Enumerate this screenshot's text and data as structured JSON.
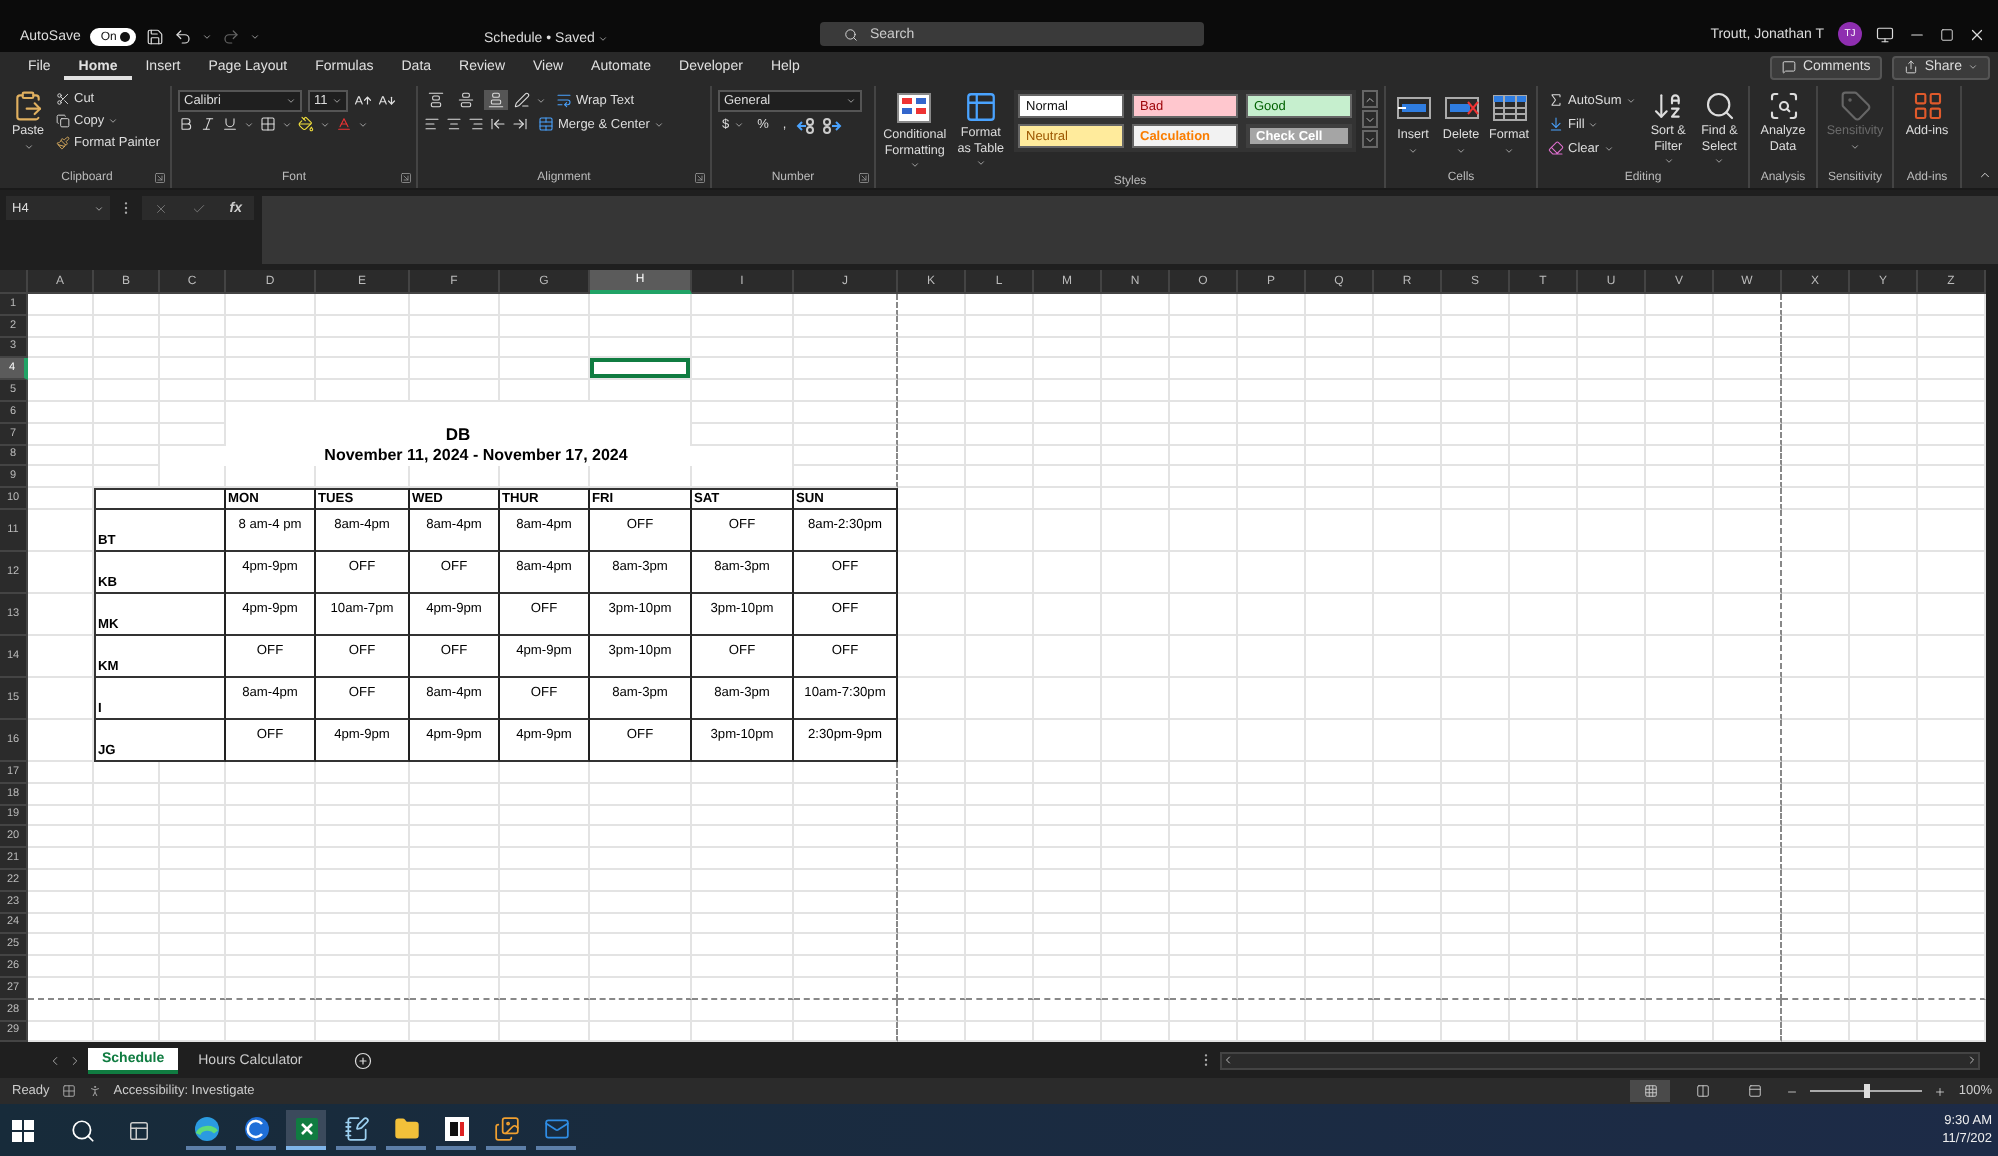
{
  "title_bar": {
    "autosave_label": "AutoSave",
    "autosave_state": "On",
    "autosave_on": true,
    "document_title": "Schedule • Saved",
    "search_placeholder": "Search",
    "user_name": "Troutt, Jonathan T",
    "user_initials": "TJ"
  },
  "menu_tabs": [
    {
      "label": "File",
      "selected": false
    },
    {
      "label": "Home",
      "selected": true
    },
    {
      "label": "Insert",
      "selected": false
    },
    {
      "label": "Page Layout",
      "selected": false
    },
    {
      "label": "Formulas",
      "selected": false
    },
    {
      "label": "Data",
      "selected": false
    },
    {
      "label": "Review",
      "selected": false
    },
    {
      "label": "View",
      "selected": false
    },
    {
      "label": "Automate",
      "selected": false
    },
    {
      "label": "Developer",
      "selected": false
    },
    {
      "label": "Help",
      "selected": false
    }
  ],
  "comments_button": "Comments",
  "share_button": "Share",
  "ribbon_groups": [
    {
      "kind": "clipboard",
      "label": "Clipboard",
      "paste": "Paste",
      "cut": "Cut",
      "copy": "Copy",
      "format_painter": "Format Painter"
    },
    {
      "kind": "font",
      "label": "Font",
      "font_name": "Calibri",
      "font_size": "11"
    },
    {
      "kind": "alignment",
      "label": "Alignment",
      "wrap_text": "Wrap Text",
      "merge_center": "Merge & Center",
      "vertical_alignment": [
        {
          "kind": "top",
          "selected": false
        },
        {
          "kind": "middle",
          "selected": false
        },
        {
          "kind": "bottom",
          "selected": true
        }
      ]
    },
    {
      "kind": "number",
      "label": "Number",
      "format": "General",
      "currency": "$",
      "percent": "%",
      "comma": ","
    },
    {
      "kind": "styles",
      "label": "Styles",
      "conditional": "Conditional Formatting",
      "format_table": "Format as Table",
      "cell_styles": [
        {
          "kind": "normal",
          "label": "Normal"
        },
        {
          "kind": "bad",
          "label": "Bad"
        },
        {
          "kind": "good",
          "label": "Good"
        },
        {
          "kind": "neutral",
          "label": "Neutral"
        },
        {
          "kind": "calculation",
          "label": "Calculation"
        },
        {
          "kind": "check",
          "label": "Check Cell"
        }
      ]
    },
    {
      "kind": "cells",
      "label": "Cells",
      "buttons": [
        "Insert",
        "Delete",
        "Format"
      ]
    },
    {
      "kind": "editing",
      "label": "Editing",
      "autosum": "AutoSum",
      "fill": "Fill",
      "clear": "Clear",
      "sort": "Sort & Filter",
      "find": "Find & Select"
    },
    {
      "kind": "analysis",
      "label": "Analysis",
      "button": "Analyze Data"
    },
    {
      "kind": "sensitivity",
      "label": "Sensitivity",
      "button": "Sensitivity",
      "disabled": true
    },
    {
      "kind": "addins",
      "label": "Add-ins",
      "button": "Add-ins"
    }
  ],
  "formula_bar": {
    "name_box": "H4",
    "function_label": "fx"
  },
  "column_headers": [
    {
      "label": "A",
      "selected": false
    },
    {
      "label": "B",
      "selected": false
    },
    {
      "label": "C",
      "selected": false
    },
    {
      "label": "D",
      "selected": false
    },
    {
      "label": "E",
      "selected": false
    },
    {
      "label": "F",
      "selected": false
    },
    {
      "label": "G",
      "selected": false
    },
    {
      "label": "H",
      "selected": true
    },
    {
      "label": "I",
      "selected": false
    },
    {
      "label": "J",
      "selected": false
    },
    {
      "label": "K",
      "selected": false
    },
    {
      "label": "L",
      "selected": false
    },
    {
      "label": "M",
      "selected": false
    },
    {
      "label": "N",
      "selected": false
    },
    {
      "label": "O",
      "selected": false
    },
    {
      "label": "P",
      "selected": false
    },
    {
      "label": "Q",
      "selected": false
    },
    {
      "label": "R",
      "selected": false
    },
    {
      "label": "S",
      "selected": false
    },
    {
      "label": "T",
      "selected": false
    },
    {
      "label": "U",
      "selected": false
    },
    {
      "label": "V",
      "selected": false
    },
    {
      "label": "W",
      "selected": false
    },
    {
      "label": "X",
      "selected": false
    },
    {
      "label": "Y",
      "selected": false
    },
    {
      "label": "Z",
      "selected": false
    }
  ],
  "row_headers": [
    {
      "label": "1",
      "selected": false
    },
    {
      "label": "2",
      "selected": false
    },
    {
      "label": "3",
      "selected": false
    },
    {
      "label": "4",
      "selected": true
    },
    {
      "label": "5",
      "selected": false
    },
    {
      "label": "6",
      "selected": false
    },
    {
      "label": "7",
      "selected": false
    },
    {
      "label": "8",
      "selected": false
    },
    {
      "label": "9",
      "selected": false
    },
    {
      "label": "10",
      "selected": false
    },
    {
      "label": "11",
      "selected": false
    },
    {
      "label": "12",
      "selected": false
    },
    {
      "label": "13",
      "selected": false
    },
    {
      "label": "14",
      "selected": false
    },
    {
      "label": "15",
      "selected": false
    },
    {
      "label": "16",
      "selected": false
    },
    {
      "label": "17",
      "selected": false
    },
    {
      "label": "18",
      "selected": false
    },
    {
      "label": "19",
      "selected": false
    },
    {
      "label": "20",
      "selected": false
    },
    {
      "label": "21",
      "selected": false
    },
    {
      "label": "22",
      "selected": false
    },
    {
      "label": "23",
      "selected": false
    },
    {
      "label": "24",
      "selected": false
    },
    {
      "label": "25",
      "selected": false
    },
    {
      "label": "26",
      "selected": false
    },
    {
      "label": "27",
      "selected": false
    },
    {
      "label": "28",
      "selected": false
    },
    {
      "label": "29",
      "selected": false
    }
  ],
  "sheet": {
    "title": "DB",
    "date_range": "November 11, 2024 - November 17, 2024",
    "days": [
      "MON",
      "TUES",
      "WED",
      "THUR",
      "FRI",
      "SAT",
      "SUN"
    ],
    "employees": [
      {
        "name": "BT",
        "shifts": [
          "8 am-4 pm",
          "8am-4pm",
          "8am-4pm",
          "8am-4pm",
          "OFF",
          "OFF",
          "8am-2:30pm"
        ]
      },
      {
        "name": "KB",
        "shifts": [
          "4pm-9pm",
          "OFF",
          "OFF",
          "8am-4pm",
          "8am-3pm",
          "8am-3pm",
          "OFF"
        ]
      },
      {
        "name": "MK",
        "shifts": [
          "4pm-9pm",
          "10am-7pm",
          "4pm-9pm",
          "OFF",
          "3pm-10pm",
          "3pm-10pm",
          "OFF"
        ]
      },
      {
        "name": "KM",
        "shifts": [
          "OFF",
          "OFF",
          "OFF",
          "4pm-9pm",
          "3pm-10pm",
          "OFF",
          "OFF"
        ]
      },
      {
        "name": "I",
        "shifts": [
          "8am-4pm",
          "OFF",
          "8am-4pm",
          "OFF",
          "8am-3pm",
          "8am-3pm",
          "10am-7:30pm"
        ]
      },
      {
        "name": "JG",
        "shifts": [
          "OFF",
          "4pm-9pm",
          "4pm-9pm",
          "4pm-9pm",
          "OFF",
          "3pm-10pm",
          "2:30pm-9pm"
        ]
      }
    ]
  },
  "sheet_tabs": [
    {
      "label": "Schedule",
      "selected": true
    },
    {
      "label": "Hours Calculator",
      "selected": false
    }
  ],
  "status_bar": {
    "ready": "Ready",
    "accessibility": "Accessibility: Investigate",
    "view_modes": [
      {
        "kind": "normal",
        "selected": true
      },
      {
        "kind": "page_layout",
        "selected": false
      },
      {
        "kind": "page_break",
        "selected": false
      }
    ],
    "zoom": {
      "level": 0.5,
      "reading": "100%"
    }
  },
  "taskbar": {
    "apps": [
      {
        "kind": "browser",
        "selected": false
      },
      {
        "kind": "circle",
        "selected": false
      },
      {
        "kind": "spreadsheet",
        "selected": true
      },
      {
        "kind": "notepad",
        "selected": false
      },
      {
        "kind": "folder",
        "selected": false
      },
      {
        "kind": "tile",
        "selected": false
      },
      {
        "kind": "gallery",
        "selected": false
      },
      {
        "kind": "mail",
        "selected": false
      }
    ],
    "time": "9:30 AM",
    "date": "11/7/202"
  }
}
